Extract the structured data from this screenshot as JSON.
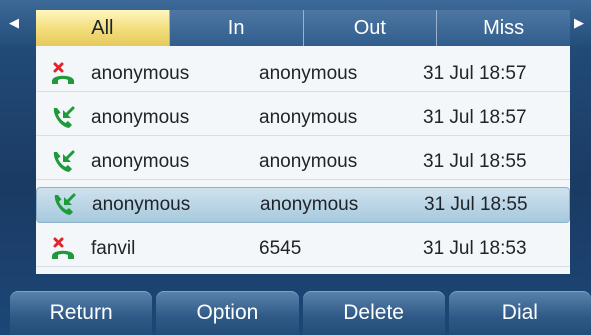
{
  "tabs": {
    "items": [
      {
        "label": "All"
      },
      {
        "label": "In"
      },
      {
        "label": "Out"
      },
      {
        "label": "Miss"
      }
    ],
    "active": "All"
  },
  "calls": [
    {
      "name": "anonymous",
      "number": "anonymous",
      "time": "31 Jul 18:57",
      "type": "missed",
      "icon": "missed-call-icon"
    },
    {
      "name": "anonymous",
      "number": "anonymous",
      "time": "31 Jul 18:57",
      "type": "incoming",
      "icon": "incoming-call-icon"
    },
    {
      "name": "anonymous",
      "number": "anonymous",
      "time": "31 Jul 18:55",
      "type": "incoming",
      "icon": "incoming-call-icon"
    },
    {
      "name": "anonymous",
      "number": "anonymous",
      "time": "31 Jul 18:55",
      "type": "incoming",
      "icon": "incoming-call-icon",
      "selected": true
    },
    {
      "name": "fanvil",
      "number": "6545",
      "time": "31 Jul 18:53",
      "type": "missed",
      "icon": "missed-call-icon"
    }
  ],
  "softkeys": {
    "return_label": "Return",
    "option_label": "Option",
    "delete_label": "Delete",
    "dial_label": "Dial"
  },
  "colors": {
    "incoming": "#1f9a3a",
    "missed_red": "#e0262b",
    "missed_green": "#1f9a3a",
    "active_tab": "#f2dd7a",
    "selected_row": "#b4d0e2"
  }
}
